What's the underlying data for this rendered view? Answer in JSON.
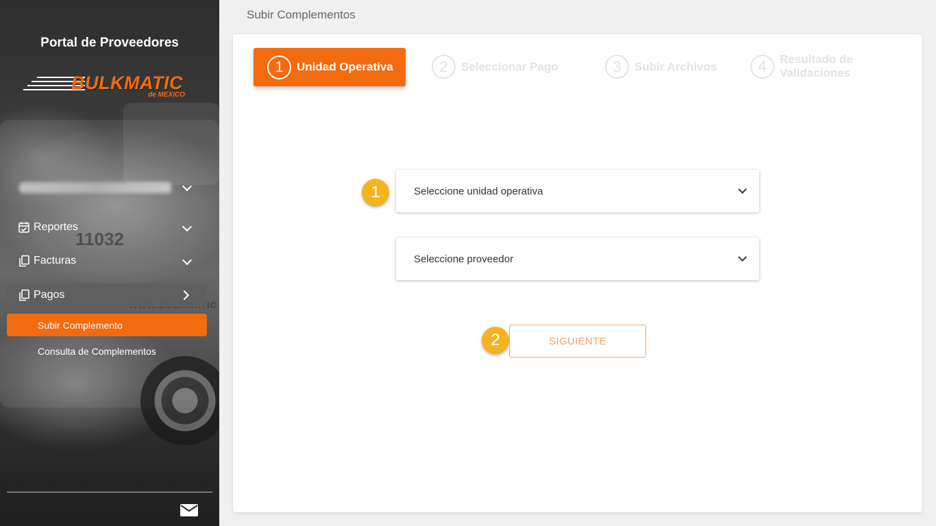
{
  "sidebar": {
    "portal_title": "Portal de Proveedores",
    "logo_word": "BULKMATIC",
    "logo_sub": "de MEXICO",
    "truck_number": "11032",
    "truck_site": "WWW.BULKMATIC",
    "nav": [
      {
        "label": "Reportes",
        "icon": "calendar-check-icon"
      },
      {
        "label": "Facturas",
        "icon": "copy-icon"
      },
      {
        "label": "Pagos",
        "icon": "copy-icon"
      }
    ],
    "sub_items": [
      "Subir Complemento",
      "Consulta de Complementos"
    ],
    "mail_icon": "envelope-icon"
  },
  "main": {
    "page_title": "Subir Complementos",
    "steps": [
      {
        "num": "1",
        "label": "Unidad Operativa"
      },
      {
        "num": "2",
        "label": "Seleccionar Pago"
      },
      {
        "num": "3",
        "label": "Subir Archivos"
      },
      {
        "num": "4",
        "label_line1": "Resultado de",
        "label_line2": "Validaciones"
      }
    ],
    "select_unidad": "Seleccione unidad operativa",
    "select_proveedor": "Seleccione proveedor",
    "badge1": "1",
    "badge2": "2",
    "next_button": "SIGUIENTE"
  },
  "colors": {
    "accent": "#f26b0f",
    "badge": "#f5b41d",
    "step_inactive": "#e2e2e2"
  }
}
